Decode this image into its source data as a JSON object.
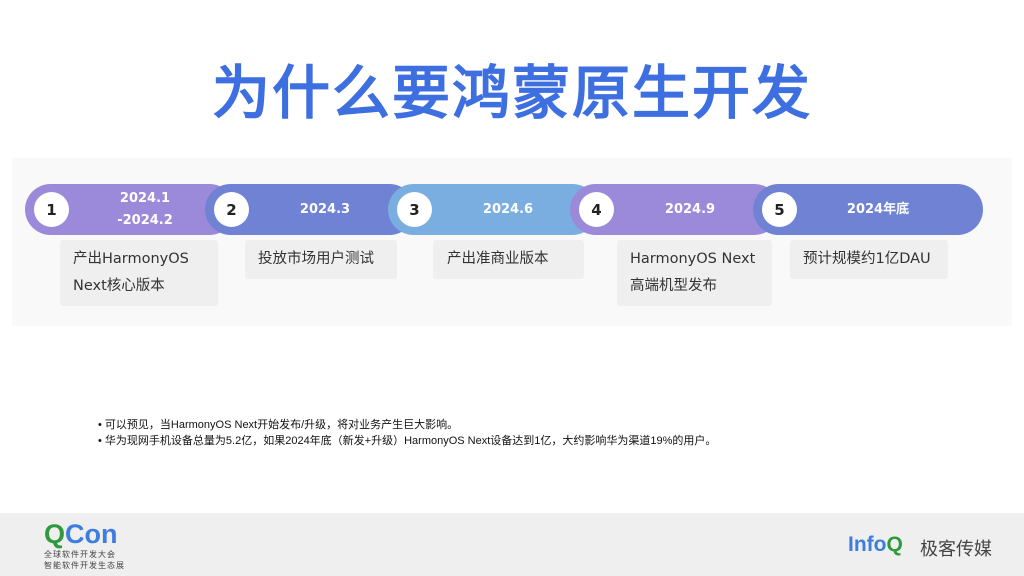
{
  "title": "为什么要鸿蒙原生开发",
  "timeline": [
    {
      "num": "1",
      "date": "2024.1\n-2024.2",
      "desc": "产出HarmonyOS\nNext核心版本",
      "color": "#9b8ad9"
    },
    {
      "num": "2",
      "date": "2024.3",
      "desc": "投放市场用户测试",
      "color": "#6f82d4"
    },
    {
      "num": "3",
      "date": "2024.6",
      "desc": "产出准商业版本",
      "color": "#7aaee0"
    },
    {
      "num": "4",
      "date": "2024.9",
      "desc": "HarmonyOS Next\n高端机型发布",
      "color": "#9b8ad9"
    },
    {
      "num": "5",
      "date": "2024年底",
      "desc": "预计规模约1亿DAU",
      "color": "#6f82d4"
    }
  ],
  "notes": [
    "可以预见，当HarmonyOS Next开始发布/升级，将对业务产生巨大影响。",
    "华为现网手机设备总量为5.2亿，如果2024年底（新发+升级）HarmonyOS Next设备达到1亿，大约影响华为渠道19%的用户。"
  ],
  "footer": {
    "qcon_q": "Q",
    "qcon_rest": "Con",
    "qcon_sub1": "全球软件开发大会",
    "qcon_sub2": "智能软件开发生态展",
    "infoq_main": "Info",
    "infoq_q": "Q",
    "jike": "极客传媒"
  }
}
